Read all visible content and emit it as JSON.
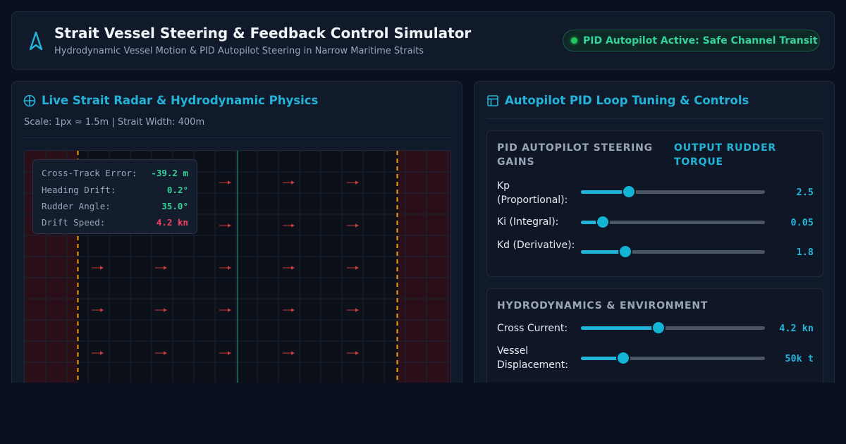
{
  "header": {
    "title": "Strait Vessel Steering & Feedback Control Simulator",
    "subtitle": "Hydrodynamic Vessel Motion & PID Autopilot Steering in Narrow Maritime Straits",
    "status": "PID Autopilot Active: Safe Channel Transit",
    "logo_icon": "navigation-arrow-icon"
  },
  "radar_panel": {
    "title": "Live Strait Radar & Hydrodynamic Physics",
    "icon": "crosshair-globe-icon",
    "scale_text": "Scale: 1px ≈ 1.5m | Strait Width: 400m",
    "current_arrow_color": "#ef4444",
    "channel_edge_color": "#f59e0b",
    "centerline_color": "#22c55e",
    "hazard_zone_color": "#3b0f1a",
    "telemetry": [
      {
        "label": "Cross-Track Error:",
        "value": "-39.2 m",
        "color": "#34d399"
      },
      {
        "label": "Heading Drift:",
        "value": "0.2°",
        "color": "#34d399"
      },
      {
        "label": "Rudder Angle:",
        "value": "35.0°",
        "color": "#34d399"
      },
      {
        "label": "Drift Speed:",
        "value": "4.2 kn",
        "color": "#f43f5e"
      }
    ]
  },
  "control_panel": {
    "title": "Autopilot PID Loop Tuning & Controls",
    "icon": "layout-panel-icon",
    "pid_card": {
      "heading": "PID AUTOPILOT STEERING GAINS",
      "output_heading": "OUTPUT RUDDER TORQUE",
      "controls": [
        {
          "label": "Kp (Proportional):",
          "value": "2.5",
          "fraction": 0.26
        },
        {
          "label": "Ki (Integral):",
          "value": "0.05",
          "fraction": 0.12
        },
        {
          "label": "Kd (Derivative):",
          "value": "1.8",
          "fraction": 0.24
        }
      ]
    },
    "env_card": {
      "heading": "HYDRODYNAMICS & ENVIRONMENT",
      "controls": [
        {
          "label": "Cross Current:",
          "value": "4.2 kn",
          "fraction": 0.42
        },
        {
          "label": "Vessel Displacement:",
          "value": "50k t",
          "fraction": 0.23
        }
      ]
    },
    "accent_color": "#22b4d8"
  }
}
